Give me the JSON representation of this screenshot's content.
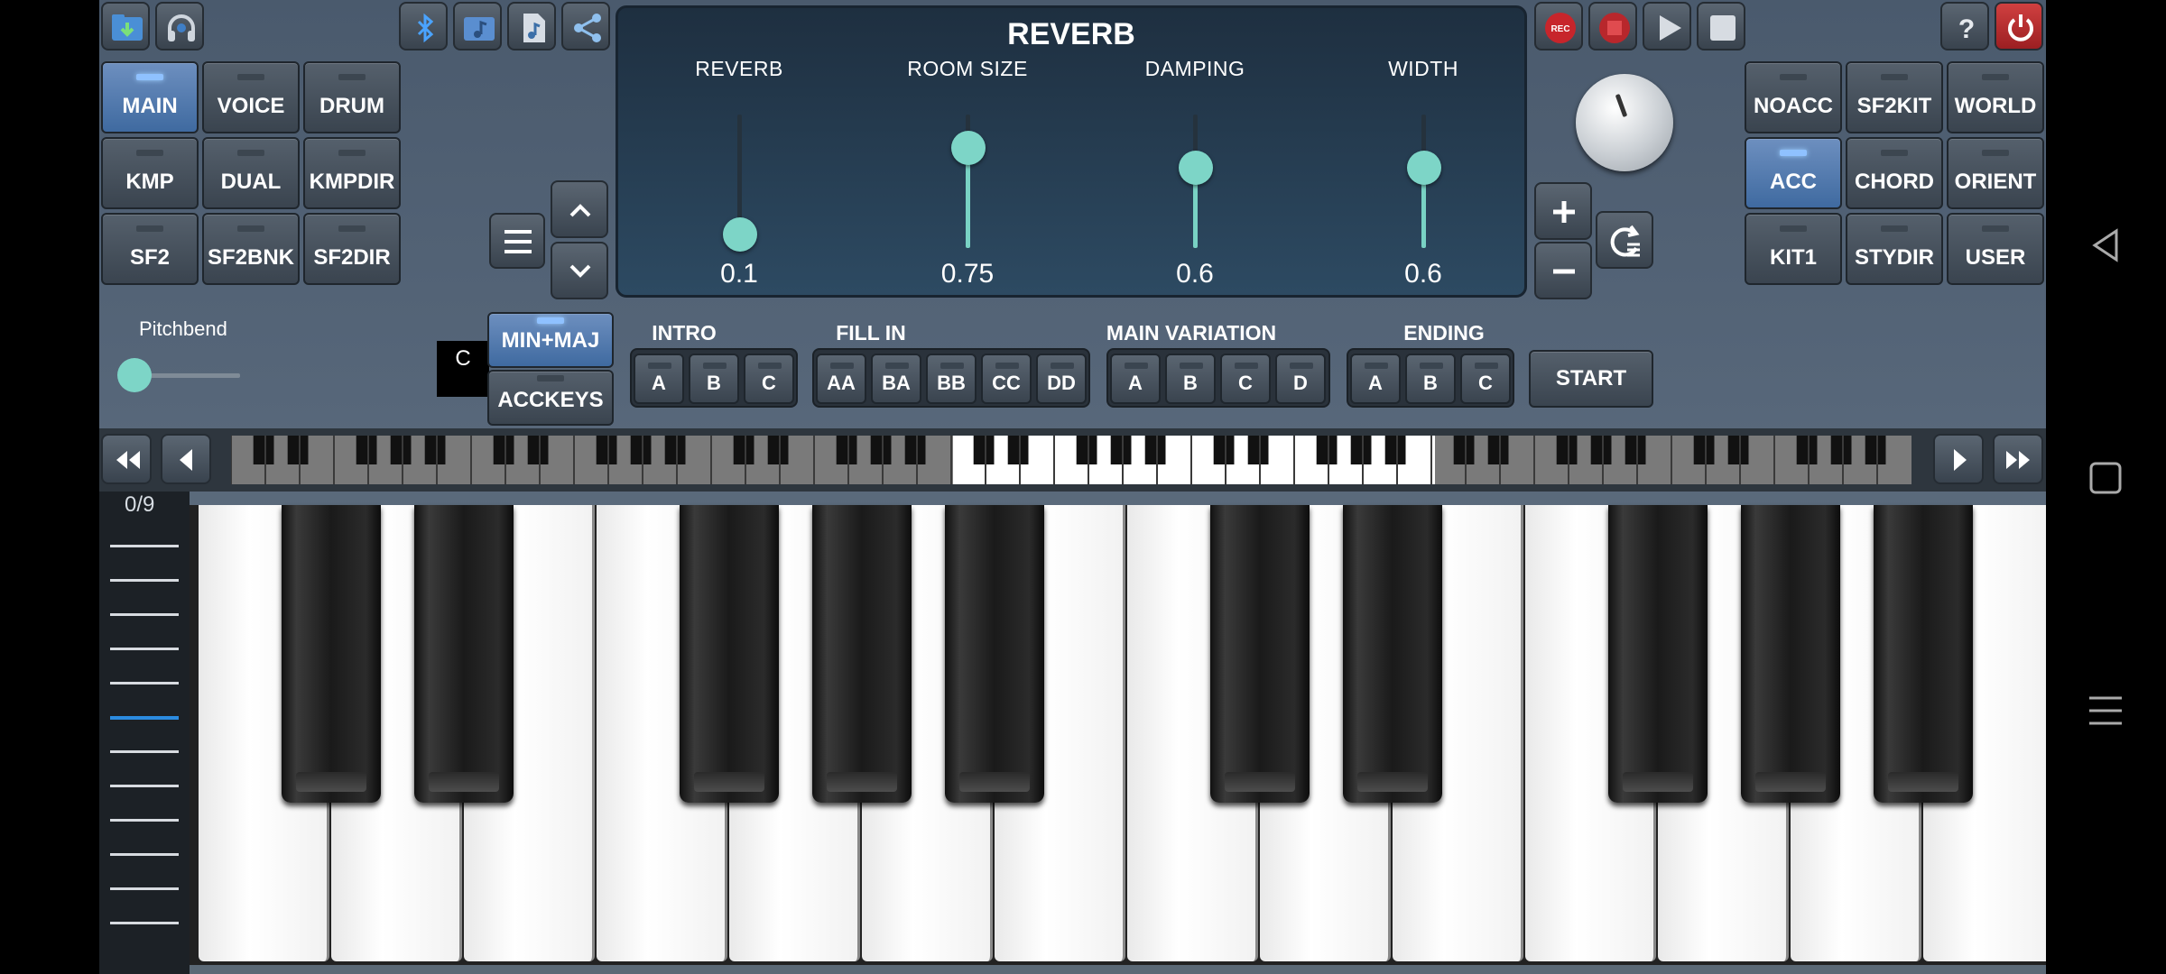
{
  "reverb": {
    "title": "REVERB",
    "sliders": [
      {
        "name": "REVERB",
        "value": "0.1",
        "level": 0.1
      },
      {
        "name": "ROOM SIZE",
        "value": "0.75",
        "level": 0.75
      },
      {
        "name": "DAMPING",
        "value": "0.6",
        "level": 0.6
      },
      {
        "name": "WIDTH",
        "value": "0.6",
        "level": 0.6
      }
    ]
  },
  "left_grid": [
    "MAIN",
    "VOICE",
    "DRUM",
    "KMP",
    "DUAL",
    "KMPDIR",
    "SF2",
    "SF2BNK",
    "SF2DIR"
  ],
  "right_grid": [
    "NOACC",
    "SF2KIT",
    "WORLD",
    "ACC",
    "CHORD",
    "ORIENT",
    "KIT1",
    "STYDIR",
    "USER"
  ],
  "pitchbend": {
    "label": "Pitchbend",
    "level": 0.0
  },
  "chord_key": "C",
  "mode_buttons": {
    "min_maj": "MIN+MAJ",
    "acckeys": "ACCKEYS"
  },
  "groups": {
    "intro": {
      "label": "INTRO",
      "buttons": [
        "A",
        "B",
        "C"
      ]
    },
    "fill_in": {
      "label": "FILL IN",
      "buttons": [
        "AA",
        "BA",
        "BB",
        "CC",
        "DD"
      ]
    },
    "main_variation": {
      "label": "MAIN VARIATION",
      "buttons": [
        "A",
        "B",
        "C",
        "D"
      ]
    },
    "ending": {
      "label": "ENDING",
      "buttons": [
        "A",
        "B",
        "C"
      ]
    }
  },
  "start_label": "START",
  "octave_counter": "0/9",
  "toolbar_icons": [
    "folder-download-icon",
    "headphones-icon",
    "bluetooth-icon",
    "music-folder-icon",
    "music-file-icon",
    "share-icon",
    "record-icon",
    "stop-record-icon",
    "play-icon",
    "stop-icon",
    "help-icon",
    "power-icon"
  ]
}
